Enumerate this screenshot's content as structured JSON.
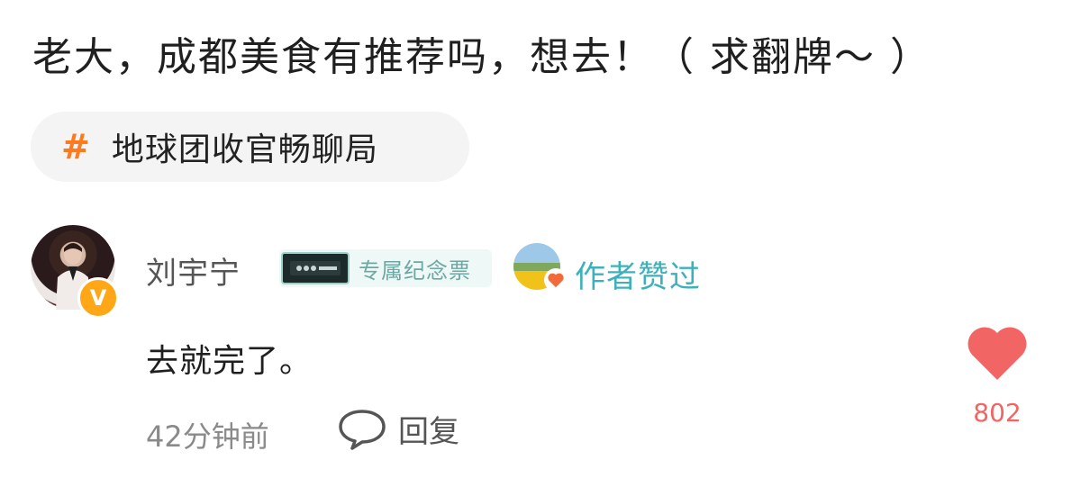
{
  "post": {
    "text": "老大，成都美食有推荐吗，想去！（ 求翻牌～ ）",
    "topic": {
      "hash": "#",
      "label": "地球团收官畅聊局"
    }
  },
  "comment": {
    "username": "刘宇宁",
    "verified_badge": "V",
    "ticket_badge_label": "专属纪念票",
    "liked_by_author_label": "作者赞过",
    "text": "去就完了。",
    "time": "42分钟前",
    "reply_label": "回复",
    "like_count": "802"
  },
  "colors": {
    "accent_orange": "#ff7a1f",
    "liked_teal": "#3bb1bb",
    "like_red": "#f26565",
    "verified_yellow": "#ffa716"
  },
  "icons": {
    "topic": "hashtag-icon",
    "reply": "speech-bubble-icon",
    "like": "heart-icon",
    "liked": "heart-icon"
  }
}
